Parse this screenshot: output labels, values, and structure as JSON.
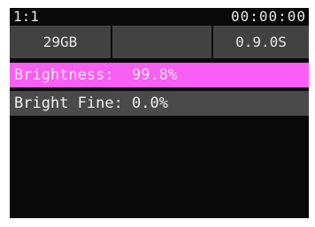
{
  "top_bar": {
    "ratio": "1:1",
    "time": "00:00:00"
  },
  "status": {
    "storage": "29GB",
    "middle": "",
    "version": "0.9.0S"
  },
  "menu": {
    "items": [
      {
        "label": "Brightness:  99.8%",
        "selected": true,
        "color": "#f95ef5"
      },
      {
        "label": "Bright Fine: 0.0%",
        "selected": false,
        "color": "#4a4a4a"
      }
    ]
  }
}
